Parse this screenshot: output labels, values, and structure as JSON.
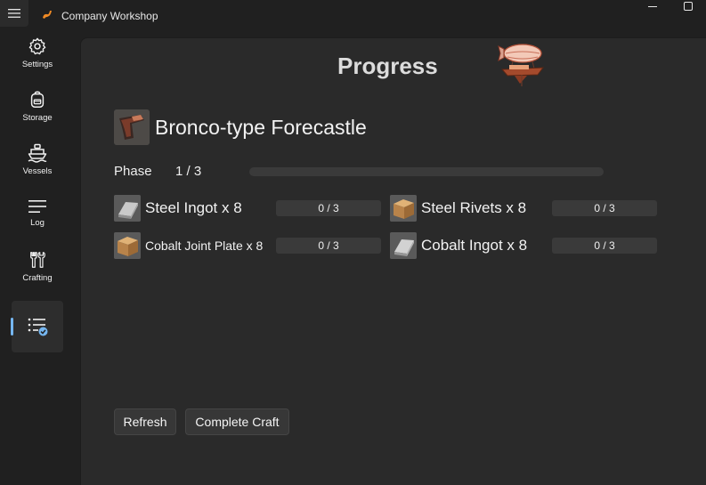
{
  "app": {
    "title": "Company Workshop"
  },
  "sidebar": {
    "items": [
      {
        "label": "Settings",
        "icon": "gear-icon"
      },
      {
        "label": "Storage",
        "icon": "backpack-icon"
      },
      {
        "label": "Vessels",
        "icon": "ship-icon"
      },
      {
        "label": "Log",
        "icon": "list-icon"
      },
      {
        "label": "Crafting",
        "icon": "tools-icon"
      },
      {
        "label": "",
        "icon": "checklist-icon",
        "active": true
      }
    ]
  },
  "page": {
    "title": "Progress"
  },
  "item": {
    "name": "Bronco-type Forecastle"
  },
  "phase": {
    "label": "Phase",
    "value": "1 / 3",
    "progress": 0
  },
  "materials": [
    {
      "name": "Steel Ingot x 8",
      "progress": "0 / 3",
      "icon": "steel-ingot-icon"
    },
    {
      "name": "Steel Rivets x 8",
      "progress": "0 / 3",
      "icon": "crate-icon"
    },
    {
      "name": "Cobalt Joint Plate x 8",
      "progress": "0 / 3",
      "icon": "crate-icon"
    },
    {
      "name": "Cobalt Ingot x 8",
      "progress": "0 / 3",
      "icon": "cobalt-ingot-icon"
    }
  ],
  "buttons": {
    "refresh": "Refresh",
    "complete": "Complete Craft"
  },
  "colors": {
    "accent": "#75b6f0",
    "background": "#202020",
    "panel": "#2a2a2a"
  }
}
